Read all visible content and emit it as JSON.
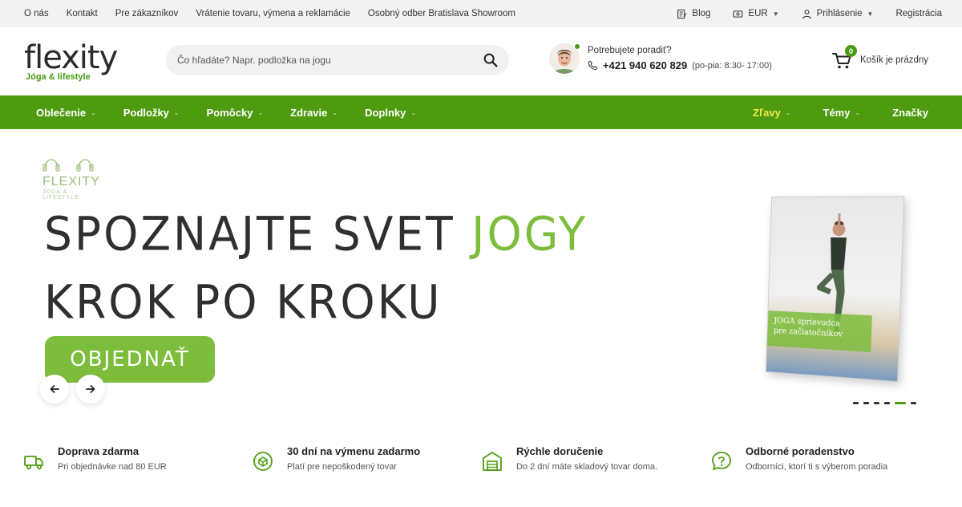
{
  "topbar": {
    "links": [
      "O nás",
      "Kontakt",
      "Pre zákazníkov",
      "Vrátenie tovaru, výmena a reklamácie",
      "Osobný odber Bratislava Showroom"
    ],
    "blog": "Blog",
    "currency": "EUR",
    "login": "Prihlásenie",
    "register": "Registrácia"
  },
  "header": {
    "logo_word": "flexity",
    "logo_tag": "Jóga & lifestyle",
    "search_placeholder": "Čo hľadáte? Napr. podložka na jogu",
    "support_question": "Potrebujete poradiť?",
    "phone": "+421 940 620 829",
    "hours": "(po-pia: 8:30- 17:00)",
    "cart_count": "0",
    "cart_label": "Košík je prázdny"
  },
  "nav": {
    "left": [
      "Oblečenie",
      "Podložky",
      "Pomôcky",
      "Zdravie",
      "Doplnky"
    ],
    "right": [
      "Zľavy",
      "Témy",
      "Značky"
    ]
  },
  "hero": {
    "logo_brand": "FLEXITY",
    "logo_small": "JOGA & LIFESTYLE",
    "line1": "SPOZNAJTE SVET ",
    "line1_accent": "JOGY",
    "line2": "KROK PO KROKU",
    "cta": "OBJEDNAŤ",
    "book_title_1": "JOGA sprievodca",
    "book_title_2": "pre začiatočníkov",
    "slides": 6,
    "active_slide": 5
  },
  "benefits": [
    {
      "title": "Doprava zdarma",
      "sub": "Pri objednávke nad 80 EUR",
      "icon": "truck-icon"
    },
    {
      "title": "30 dní na výmenu zadarmo",
      "sub": "Platí pre nepoškodený tovar",
      "icon": "return-icon"
    },
    {
      "title": "Rýchle doručenie",
      "sub": "Do 2 dní máte skladový tovar doma.",
      "icon": "warehouse-icon"
    },
    {
      "title": "Odborné poradenstvo",
      "sub": "Odborníci, ktorí ti s výberom poradia",
      "icon": "chat-question-icon"
    }
  ],
  "colors": {
    "brand_green": "#4e9b10",
    "accent_green": "#7dbd3c",
    "sale_yellow": "#f4e94a"
  }
}
